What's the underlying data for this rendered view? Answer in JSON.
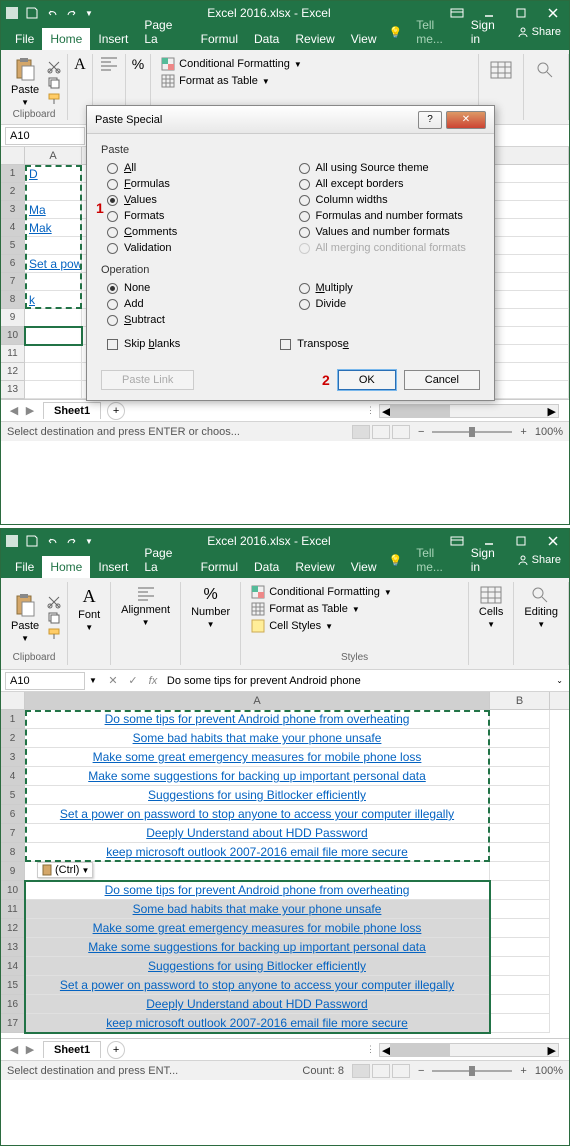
{
  "win1": {
    "title": "Excel 2016.xlsx - Excel",
    "tabs": [
      "File",
      "Home",
      "Insert",
      "Page La",
      "Formul",
      "Data",
      "Review",
      "View"
    ],
    "active_tab": "Home",
    "tellme": "Tell me...",
    "signin": "Sign in",
    "share": "Share",
    "ribbon": {
      "paste": "Paste",
      "clipboard": "Clipboard",
      "font": "Font",
      "alignment": "Alignment",
      "number": "Number",
      "cond_fmt": "Conditional Formatting",
      "fmt_table": "Format as Table",
      "cell_styles": "Cell Styles",
      "styles": "Styles",
      "cells": "Cells",
      "editing": "Editing"
    },
    "namebox": "A10",
    "formula": "",
    "rows": [
      {
        "n": "1",
        "a": "D"
      },
      {
        "n": "2",
        "a": ""
      },
      {
        "n": "3",
        "a": "Ma"
      },
      {
        "n": "4",
        "a": "Mak"
      },
      {
        "n": "5",
        "a": ""
      },
      {
        "n": "6",
        "a": "Set a pow"
      },
      {
        "n": "7",
        "a": ""
      },
      {
        "n": "8",
        "a": "k"
      },
      {
        "n": "9",
        "a": ""
      },
      {
        "n": "10",
        "a": ""
      },
      {
        "n": "11",
        "a": ""
      },
      {
        "n": "12",
        "a": ""
      },
      {
        "n": "13",
        "a": ""
      }
    ],
    "sheet": "Sheet1",
    "status": "Select destination and press ENTER or choos...",
    "zoom": "100%"
  },
  "dialog": {
    "title": "Paste Special",
    "paste": "Paste",
    "operation": "Operation",
    "radios_left": [
      "All",
      "Formulas",
      "Values",
      "Formats",
      "Comments",
      "Validation"
    ],
    "radios_right": [
      "All using Source theme",
      "All except borders",
      "Column widths",
      "Formulas and number formats",
      "Values and number formats",
      "All merging conditional formats"
    ],
    "op_left": [
      "None",
      "Add",
      "Subtract"
    ],
    "op_right": [
      "Multiply",
      "Divide"
    ],
    "skip_blanks": "Skip blanks",
    "transpose": "Transpose",
    "paste_link": "Paste Link",
    "ok": "OK",
    "cancel": "Cancel",
    "anno1": "1",
    "anno2": "2"
  },
  "win2": {
    "title": "Excel 2016.xlsx - Excel",
    "namebox": "A10",
    "formula": "Do some tips for prevent Android phone",
    "data_rows": [
      "Do some tips for prevent Android phone from overheating",
      "Some bad habits that make your phone unsafe",
      "Make some great emergency measures for mobile phone loss",
      "Make some suggestions for backing up important personal data",
      "Suggestions for using Bitlocker efficiently",
      "Set a power on password to stop anyone to access your computer illegally",
      "Deeply Understand about HDD Password",
      "keep microsoft outlook 2007-2016 email file more secure"
    ],
    "paste_opts": "(Ctrl)",
    "sheet": "Sheet1",
    "status": "Select destination and press ENT...",
    "count_label": "Count: 8",
    "zoom": "100%"
  },
  "cols": {
    "a": "A",
    "b": "B"
  }
}
